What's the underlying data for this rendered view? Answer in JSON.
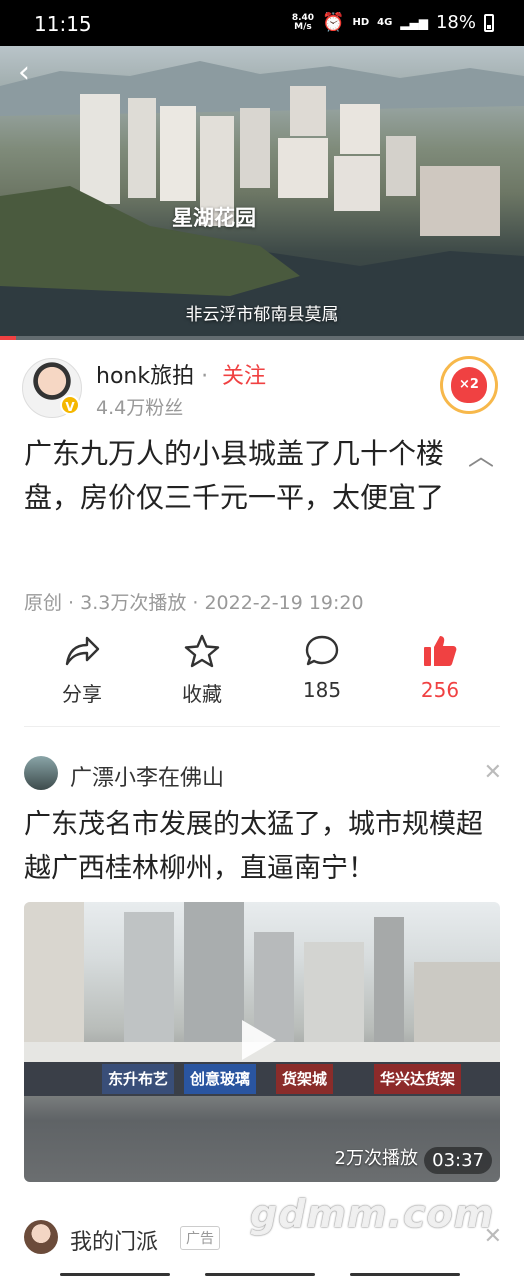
{
  "status_bar": {
    "time": "11:15",
    "net_speed_top": "8.40",
    "net_speed_bottom": "M/s",
    "hd": "HD",
    "network": "4G",
    "battery": "18%"
  },
  "video": {
    "overlay_title": "星湖花园",
    "subtitle": "非云浮市郁南县莫属",
    "progress": 0.03
  },
  "author": {
    "name": "honk旅拍",
    "separator": "·",
    "follow_label": "关注",
    "fans": "4.4万粉丝",
    "verified_mark": "V",
    "badge_label": "×2"
  },
  "article": {
    "title": "广东九万人的小县城盖了几十个楼盘，房价仅三千元一平，太便宜了",
    "meta": "原创 · 3.3万次播放 · 2022-2-19 19:20"
  },
  "actions": {
    "share": "分享",
    "favorite": "收藏",
    "comments": "185",
    "likes": "256"
  },
  "feed_item": {
    "author": "广漂小李在佛山",
    "title": "广东茂名市发展的太猛了，城市规模超越广西桂林柳州，直逼南宁！",
    "shops": [
      "东升布艺",
      "创意玻璃",
      "货架城",
      "华兴达货架"
    ],
    "play_count": "2万次播放",
    "duration": "03:37"
  },
  "next_item": {
    "author": "我的门派",
    "ad_label": "广告"
  },
  "watermark": "gdmm.com",
  "colors": {
    "accent": "#f04142",
    "muted": "#999999"
  }
}
